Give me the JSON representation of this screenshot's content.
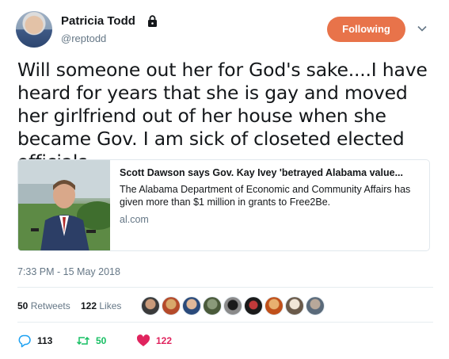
{
  "author": {
    "name": "Patricia Todd",
    "handle": "@reptodd"
  },
  "follow_button": {
    "label": "Following"
  },
  "tweet": {
    "text": "Will someone out her for God's sake....I have heard for years that she is gay and moved her girlfriend out of her house when she became Gov.  I am sick of closeted elected officials."
  },
  "card": {
    "title": "Scott Dawson says Gov. Kay Ivey 'betrayed Alabama value...",
    "description": "The Alabama Department of Economic and Community Affairs has given more than $1 million in grants to Free2Be.",
    "domain": "al.com"
  },
  "timestamp": "7:33 PM - 15 May 2018",
  "stats": {
    "retweets_count": "50",
    "retweets_label": "Retweets",
    "likes_count": "122",
    "likes_label": "Likes"
  },
  "actions": {
    "reply_count": "113",
    "retweet_count": "50",
    "like_count": "122"
  },
  "colors": {
    "follow": "#e8734a",
    "retweet": "#17bf63",
    "like": "#e0245e",
    "reply": "#1da1f2",
    "muted": "#657786"
  },
  "icons": {
    "lock": "lock-icon",
    "chevron": "chevron-down-icon",
    "reply": "reply-icon",
    "retweet": "retweet-icon",
    "like": "heart-icon"
  }
}
